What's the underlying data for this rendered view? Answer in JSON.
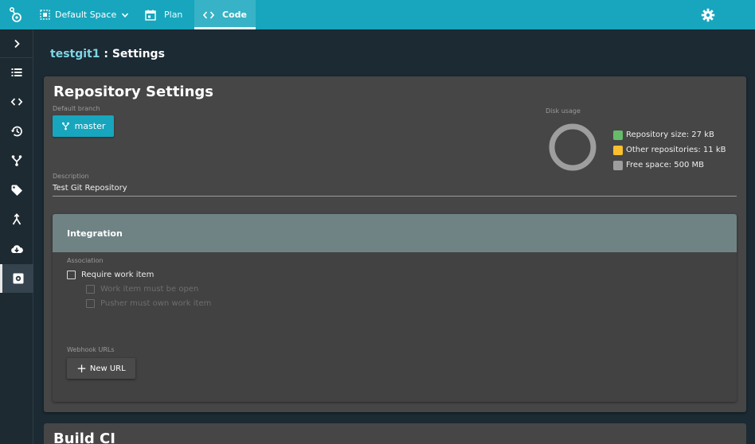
{
  "topbar": {
    "space_label": "Default Space",
    "tabs": [
      {
        "label": "Plan",
        "icon": "calendar-icon",
        "active": false
      },
      {
        "label": "Code",
        "icon": "code-icon",
        "active": true
      }
    ],
    "accent_color": "#17a6bd"
  },
  "sidebar": {
    "items": [
      {
        "name": "expand",
        "icon": "chevron-right-icon"
      },
      {
        "name": "list",
        "icon": "list-icon"
      },
      {
        "name": "code",
        "icon": "code-icon"
      },
      {
        "name": "history",
        "icon": "history-icon"
      },
      {
        "name": "branches",
        "icon": "branch-icon"
      },
      {
        "name": "tags",
        "icon": "tag-icon"
      },
      {
        "name": "merge",
        "icon": "merge-icon"
      },
      {
        "name": "download",
        "icon": "cloud-download-icon"
      },
      {
        "name": "settings",
        "icon": "settings-icon",
        "active": true
      }
    ]
  },
  "breadcrumb": {
    "repo": "testgit1",
    "page": " : Settings"
  },
  "repo_settings": {
    "title": "Repository Settings",
    "default_branch_label": "Default branch",
    "default_branch_value": "master",
    "disk_usage_label": "Disk usage",
    "legend": [
      {
        "label": "Repository size: 27 kB",
        "color": "#66bb6a"
      },
      {
        "label": "Other repositories: 11 kB",
        "color": "#fbc02d"
      },
      {
        "label": "Free space: 500 MB",
        "color": "#9e9e9e"
      }
    ],
    "description_label": "Description",
    "description_value": "Test Git Repository"
  },
  "integration": {
    "title": "Integration",
    "association_label": "Association",
    "require_work_item": "Require work item",
    "work_item_open": "Work item must be open",
    "pusher_owns": "Pusher must own work item",
    "webhook_label": "Webhook URLs",
    "new_url_label": "New URL"
  },
  "build_ci": {
    "title": "Build CI"
  }
}
